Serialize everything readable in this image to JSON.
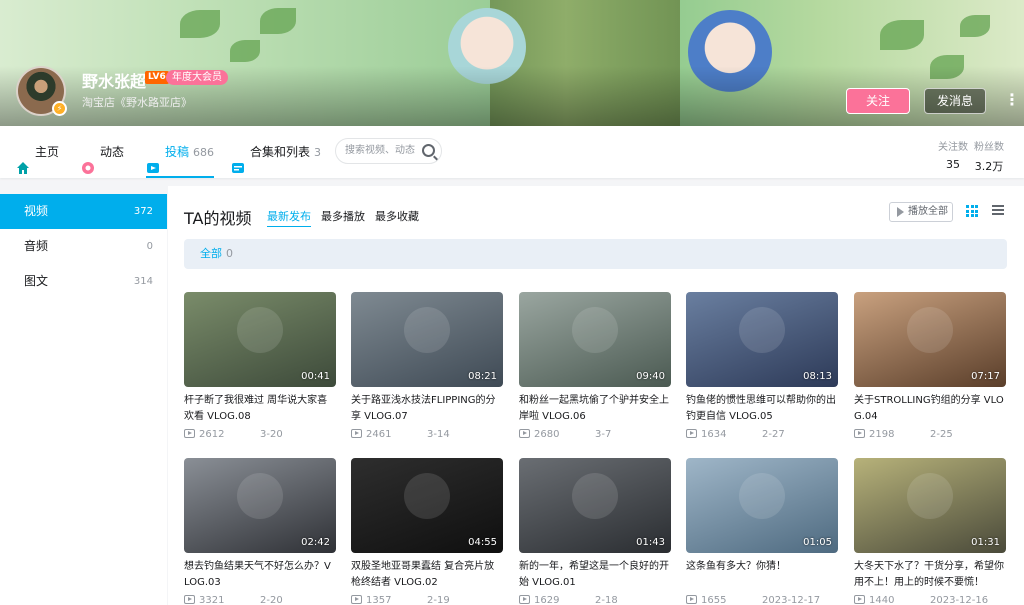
{
  "profile": {
    "name": "野水张超",
    "level": "LV6",
    "vip_label": "年度大会员",
    "sign": "淘宝店《野水路亚店》",
    "follow_label": "关注",
    "message_label": "发消息",
    "more_label": "⋮"
  },
  "nav": {
    "tabs": [
      {
        "label": "主页",
        "count": ""
      },
      {
        "label": "动态",
        "count": ""
      },
      {
        "label": "投稿",
        "count": "686"
      },
      {
        "label": "合集和列表",
        "count": "3"
      }
    ],
    "search_placeholder": "搜索视频、动态",
    "stats": [
      {
        "label": "关注数",
        "value": "35"
      },
      {
        "label": "粉丝数",
        "value": "3.2万"
      }
    ]
  },
  "sidebar": {
    "items": [
      {
        "label": "视频",
        "count": "372"
      },
      {
        "label": "音频",
        "count": "0"
      },
      {
        "label": "图文",
        "count": "314"
      }
    ]
  },
  "main": {
    "title": "TA的视频",
    "sorts": [
      "最新发布",
      "最多播放",
      "最多收藏"
    ],
    "play_all": "播放全部",
    "filter": {
      "label": "全部",
      "count": "0"
    }
  },
  "videos": [
    {
      "title": "杆子断了我很难过 周华说大家喜欢看 VLOG.08",
      "duration": "00:41",
      "views": "2612",
      "date": "3-20"
    },
    {
      "title": "关于路亚浅水技法FLIPPING的分享 VLOG.07",
      "duration": "08:21",
      "views": "2461",
      "date": "3-14"
    },
    {
      "title": "和粉丝一起黑坑偷了个驴并安全上岸啦 VLOG.06",
      "duration": "09:40",
      "views": "2680",
      "date": "3-7"
    },
    {
      "title": "钓鱼佬的惯性思维可以帮助你的出钓更自信 VLOG.05",
      "duration": "08:13",
      "views": "1634",
      "date": "2-27"
    },
    {
      "title": "关于STROLLING钓组的分享 VLOG.04",
      "duration": "07:17",
      "views": "2198",
      "date": "2-25"
    },
    {
      "title": "想去钓鱼结果天气不好怎么办？VLOG.03",
      "duration": "02:42",
      "views": "3321",
      "date": "2-20"
    },
    {
      "title": "双股圣地亚哥果蠹结 复合亮片放枪终结者 VLOG.02",
      "duration": "04:55",
      "views": "1357",
      "date": "2-19"
    },
    {
      "title": "新的一年，希望这是一个良好的开始 VLOG.01",
      "duration": "01:43",
      "views": "1629",
      "date": "2-18"
    },
    {
      "title": "这条鱼有多大？你猜！",
      "duration": "01:05",
      "views": "1655",
      "date": "2023-12-17"
    },
    {
      "title": "大冬天下水了？干货分享，希望你用不上！用上的时候不要慌！",
      "duration": "01:31",
      "views": "1440",
      "date": "2023-12-16"
    }
  ],
  "thumb_colors": [
    [
      "#7a8c6a",
      "#3d4a3a"
    ],
    [
      "#7f8a92",
      "#3f4a55"
    ],
    [
      "#9aa6a0",
      "#4b5a52"
    ],
    [
      "#6a7fa0",
      "#2d3a58"
    ],
    [
      "#c9a17f",
      "#5a3e2a"
    ],
    [
      "#8a8f96",
      "#2f3136"
    ],
    [
      "#2e2e2e",
      "#0f0f0f"
    ],
    [
      "#6a6e73",
      "#2a2d31"
    ],
    [
      "#9fb6c8",
      "#4e6a80"
    ],
    [
      "#b7b27a",
      "#4a4a3a"
    ]
  ],
  "icons": [
    "home-icon",
    "activity-icon",
    "upload-icon",
    "collection-icon",
    "search-icon",
    "play-icon",
    "grid-view-icon",
    "list-view-icon",
    "more-icon"
  ]
}
